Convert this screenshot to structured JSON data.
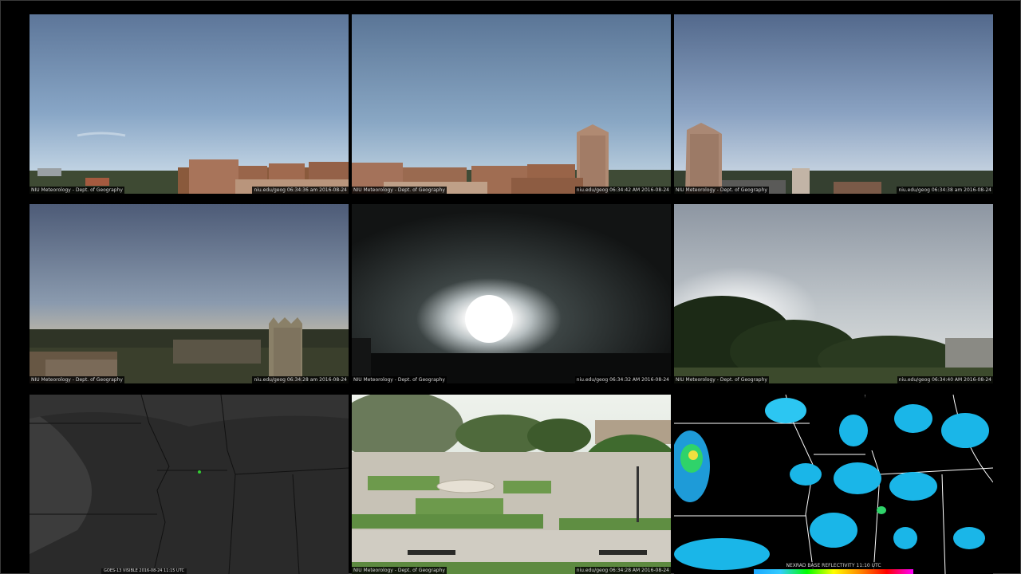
{
  "cameras": [
    {
      "caption_left": "NIU Meteorology - Dept. of Geography",
      "caption_right": "niu.edu/geog  06:34:36 am  2016-08-24"
    },
    {
      "caption_left": "NIU Meteorology - Dept. of Geography",
      "caption_right": "niu.edu/geog  06:34:42 AM  2016-08-24"
    },
    {
      "caption_left": "NIU Meteorology - Dept. of Geography",
      "caption_right": "niu.edu/geog  06:34:38 am  2016-08-24"
    },
    {
      "caption_left": "NIU Meteorology - Dept. of Geography",
      "caption_right": "niu.edu/geog  06:34:28 am  2016-08-24"
    },
    {
      "caption_left": "NIU Meteorology - Dept. of Geography",
      "caption_right": "niu.edu/geog  06:34:32 AM  2016-08-24"
    },
    {
      "caption_left": "NIU Meteorology - Dept. of Geography",
      "caption_right": "niu.edu/geog  06:34:40 AM  2016-08-24"
    },
    {
      "caption_left": "NIU Meteorology - Dept. of Geography",
      "caption_right": "niu.edu/geog  06:34:28 AM  2016-08-24"
    }
  ],
  "satellite": {
    "caption": "GOES-13 VISIBLE  2016-08-24  11:15 UTC"
  },
  "radar": {
    "caption": "NEXRAD BASE REFLECTIVITY  11:10 UTC"
  }
}
